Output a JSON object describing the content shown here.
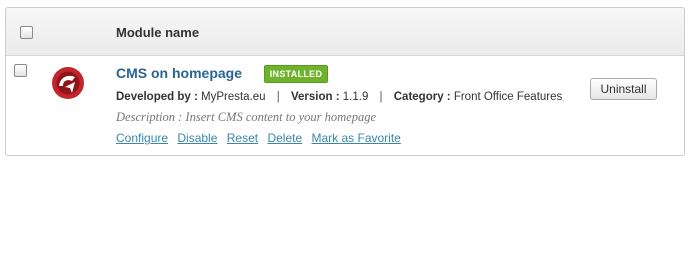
{
  "table": {
    "header": {
      "column_title": "Module name"
    },
    "module": {
      "name": "CMS on homepage",
      "status_badge": "INSTALLED",
      "developer_label": "Developed by :",
      "developer": "MyPresta.eu",
      "version_label": "Version :",
      "version": "1.1.9",
      "category_label": "Category :",
      "category": "Front Office Features",
      "separator": "|",
      "description": "Description : Insert CMS content to your homepage",
      "actions": [
        "Configure",
        "Disable",
        "Reset",
        "Delete",
        "Mark as Favorite"
      ],
      "uninstall_label": "Uninstall",
      "logo_icon": "mypresta-logo-icon"
    }
  },
  "colors": {
    "link": "#3a87ad",
    "module_title": "#2a6496",
    "badge_green": "#6eb32b",
    "logo_red": "#c2262c"
  }
}
